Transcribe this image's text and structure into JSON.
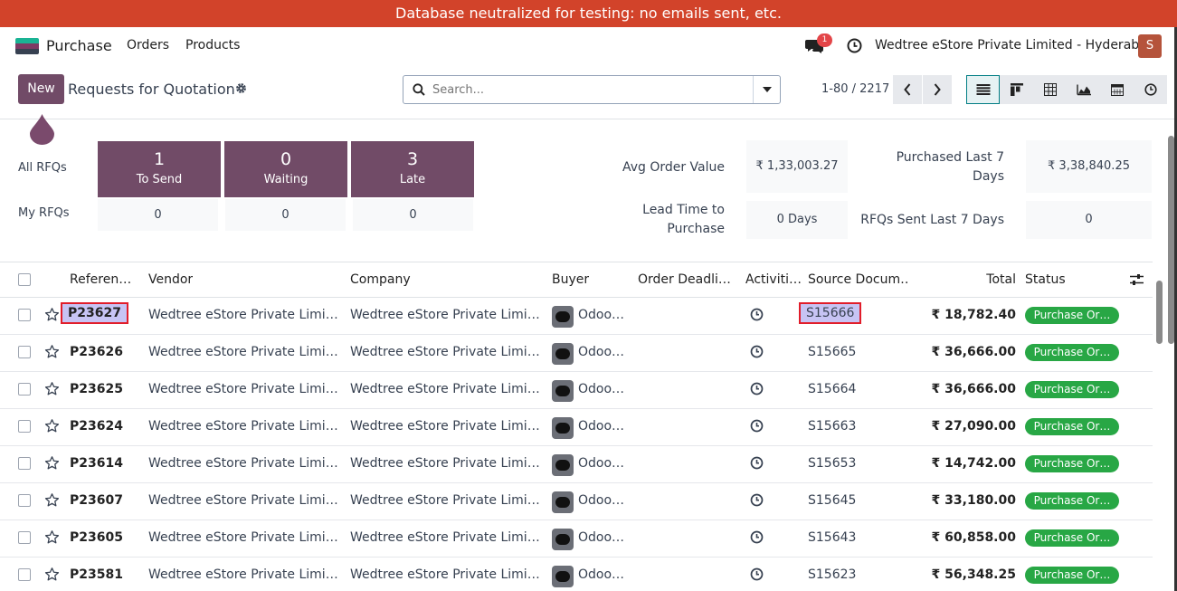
{
  "banner": "Database neutralized for testing: no emails sent, etc.",
  "navbar": {
    "app_name": "Purchase",
    "items": [
      "Orders",
      "Products"
    ],
    "chat_count": "1",
    "company": "Wedtree eStore Private Limited - Hyderabad",
    "avatar_letter": "S"
  },
  "control": {
    "new_label": "New",
    "title": "Requests for Quotation",
    "search_placeholder": "Search...",
    "pager": "1-80 / 2217"
  },
  "dashboard": {
    "all_rfqs": "All RFQs",
    "my_rfqs": "My RFQs",
    "tiles": [
      {
        "num": "1",
        "cap": "To Send"
      },
      {
        "num": "0",
        "cap": "Waiting"
      },
      {
        "num": "3",
        "cap": "Late"
      }
    ],
    "my_values": [
      "0",
      "0",
      "0"
    ],
    "avg_order_label": "Avg Order Value",
    "avg_order_value": "₹ 1,33,003.27",
    "purchased_label_1": "Purchased Last 7",
    "purchased_label_2": "Days",
    "purchased_value": "₹ 3,38,840.25",
    "lead_label_1": "Lead Time to",
    "lead_label_2": "Purchase",
    "lead_value": "0 Days",
    "rfq_sent_label": "RFQs Sent Last 7 Days",
    "rfq_sent_value": "0"
  },
  "table": {
    "headers": {
      "reference": "Referen…",
      "vendor": "Vendor",
      "company": "Company",
      "buyer": "Buyer",
      "deadline": "Order Deadli…",
      "activities": "Activiti…",
      "source": "Source Docum…",
      "total": "Total",
      "status": "Status"
    },
    "rows": [
      {
        "ref": "P23627",
        "vendor": "Wedtree eStore Private Limited…",
        "company": "Wedtree eStore Private Limited…",
        "buyer": "Odoo…",
        "source": "S15666",
        "total": "₹ 18,782.40",
        "status": "Purchase Or…"
      },
      {
        "ref": "P23626",
        "vendor": "Wedtree eStore Private Limited…",
        "company": "Wedtree eStore Private Limited…",
        "buyer": "Odoo…",
        "source": "S15665",
        "total": "₹ 36,666.00",
        "status": "Purchase Or…"
      },
      {
        "ref": "P23625",
        "vendor": "Wedtree eStore Private Limited…",
        "company": "Wedtree eStore Private Limited…",
        "buyer": "Odoo…",
        "source": "S15664",
        "total": "₹ 36,666.00",
        "status": "Purchase Or…"
      },
      {
        "ref": "P23624",
        "vendor": "Wedtree eStore Private Limited…",
        "company": "Wedtree eStore Private Limited…",
        "buyer": "Odoo…",
        "source": "S15663",
        "total": "₹ 27,090.00",
        "status": "Purchase Or…"
      },
      {
        "ref": "P23614",
        "vendor": "Wedtree eStore Private Limited…",
        "company": "Wedtree eStore Private Limited…",
        "buyer": "Odoo…",
        "source": "S15653",
        "total": "₹ 14,742.00",
        "status": "Purchase Or…"
      },
      {
        "ref": "P23607",
        "vendor": "Wedtree eStore Private Limited…",
        "company": "Wedtree eStore Private Limited…",
        "buyer": "Odoo…",
        "source": "S15645",
        "total": "₹ 33,180.00",
        "status": "Purchase Or…"
      },
      {
        "ref": "P23605",
        "vendor": "Wedtree eStore Private Limited…",
        "company": "Wedtree eStore Private Limited…",
        "buyer": "Odoo…",
        "source": "S15643",
        "total": "₹ 60,858.00",
        "status": "Purchase Or…"
      },
      {
        "ref": "P23581",
        "vendor": "Wedtree eStore Private Limited…",
        "company": "Wedtree eStore Private Limited…",
        "buyer": "Odoo…",
        "source": "S15623",
        "total": "₹ 56,348.25",
        "status": "Purchase Or…"
      }
    ]
  },
  "colors": {
    "brand": "#714b67",
    "banner": "#d2432a",
    "status_green": "#28a745",
    "highlight": "#c7c4f4"
  }
}
